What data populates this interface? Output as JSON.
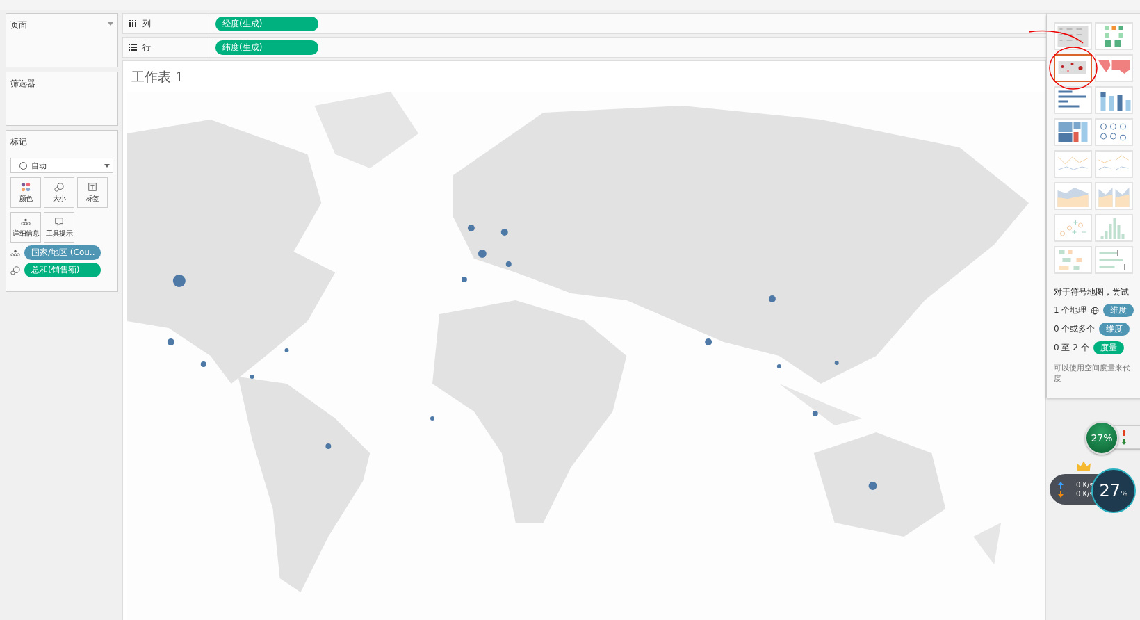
{
  "shelves": {
    "pages": {
      "label": "页面"
    },
    "filters": {
      "label": "筛选器"
    },
    "columns": {
      "label": "列",
      "pill": "经度(生成)"
    },
    "rows": {
      "label": "行",
      "pill": "纬度(生成)"
    }
  },
  "marks": {
    "label": "标记",
    "type": "自动",
    "cards": [
      {
        "kind": "color",
        "label": "颜色"
      },
      {
        "kind": "size",
        "label": "大小"
      },
      {
        "kind": "label",
        "label": "标签"
      },
      {
        "kind": "detail",
        "label": "详细信息"
      },
      {
        "kind": "tooltip",
        "label": "工具提示"
      }
    ],
    "fields": [
      {
        "kind": "detail",
        "label": "国家/地区 (Cou..",
        "color": "#4f96b4"
      },
      {
        "kind": "size",
        "label": "总和(销售额)",
        "color": "#00b180"
      }
    ]
  },
  "sheet": {
    "title": "工作表 1"
  },
  "show_me": {
    "thumbnails": [
      {
        "kind": "text-table",
        "selected": false
      },
      {
        "kind": "heat-map",
        "selected": false
      },
      {
        "kind": "symbol-map",
        "selected": true
      },
      {
        "kind": "filled-map",
        "selected": false
      },
      {
        "kind": "hbar",
        "selected": false
      },
      {
        "kind": "stacked-bar",
        "selected": false
      },
      {
        "kind": "treemap",
        "selected": false
      },
      {
        "kind": "circles",
        "selected": false
      },
      {
        "kind": "line",
        "selected": false
      },
      {
        "kind": "dual-line",
        "selected": false
      },
      {
        "kind": "area",
        "selected": false
      },
      {
        "kind": "dual-area",
        "selected": false
      },
      {
        "kind": "scatter",
        "selected": false
      },
      {
        "kind": "histogram",
        "selected": false
      },
      {
        "kind": "gantt",
        "selected": false
      },
      {
        "kind": "bullet",
        "selected": false
      }
    ],
    "hint_title": "对于符号地图，尝试",
    "requirements": [
      {
        "prefix": "1 个地理",
        "globe": true,
        "pill": "维度",
        "color": "#4f96b4"
      },
      {
        "prefix": "0 个或多个",
        "globe": false,
        "pill": "维度",
        "color": "#4f96b4"
      },
      {
        "prefix": "0 至 2 个",
        "globe": false,
        "pill": "度量",
        "color": "#00b180"
      }
    ],
    "note_lines": [
      "可以使用空间度量来代",
      "度"
    ]
  },
  "speed_widgets": {
    "ball_reading": "27%",
    "up": "0 K/s",
    "down": "0 K/s",
    "dial_reading": "27",
    "dial_unit": "%"
  }
}
